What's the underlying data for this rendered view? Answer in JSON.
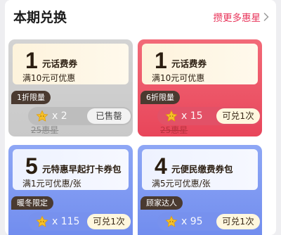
{
  "header": {
    "title": "本期兑换",
    "more_label": "攒更多惠星"
  },
  "coupons": [
    {
      "amount": "1",
      "name": "元话费券",
      "condition": "满10元可优惠",
      "tag": "1折限量",
      "count": "x 2",
      "button": "已售罄",
      "original": "25惠星",
      "sold_out": true
    },
    {
      "amount": "1",
      "name": "元话费券",
      "condition": "满10元可优惠",
      "tag": "6折限量",
      "count": "x 15",
      "button": "可兑1次",
      "original": "25惠星",
      "sold_out": false
    },
    {
      "amount": "5",
      "name": "元特惠早起打卡券包",
      "condition": "满1元可优惠/张",
      "tag": "暖冬限定",
      "count": "x 115",
      "button": "可兑1次",
      "original": "",
      "sold_out": false
    },
    {
      "amount": "4",
      "name": "元便民缴费券包",
      "condition": "满5元可优惠/张",
      "tag": "顾家达人",
      "count": "x 95",
      "button": "可兑1次",
      "original": "",
      "sold_out": false
    }
  ],
  "colors": {
    "accent": "#e8345a",
    "card_grey": "#c9c9c9",
    "card_red": "#e8455a",
    "card_blue": "#7791ee",
    "tag_bg": "#4a3a30",
    "star": "#f5b800"
  }
}
